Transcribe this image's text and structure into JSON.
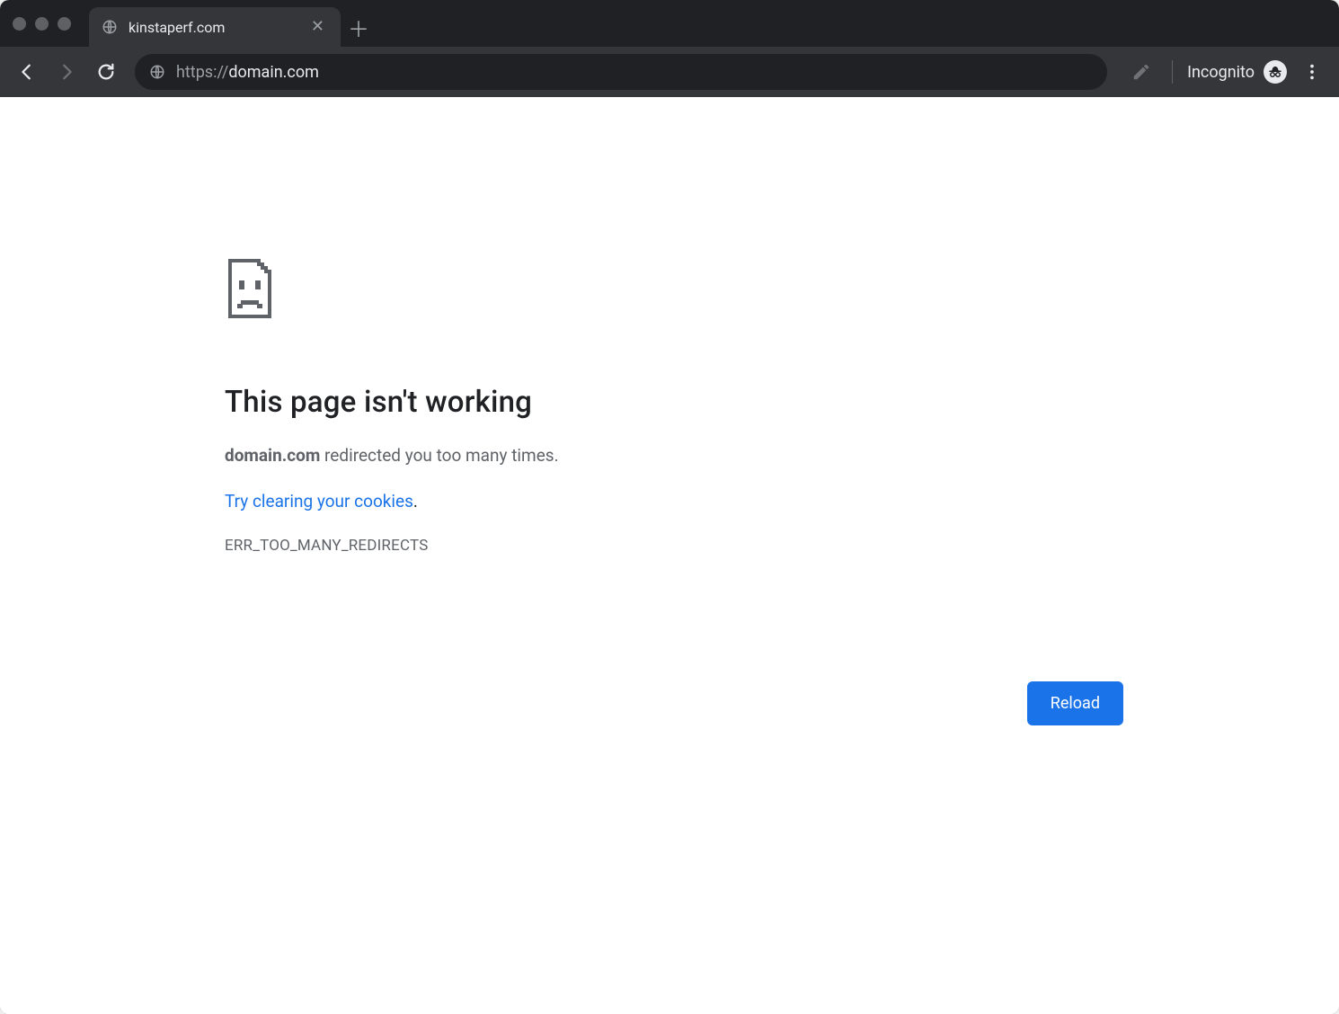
{
  "tab": {
    "title": "kinstaperf.com"
  },
  "toolbar": {
    "url_scheme": "https://",
    "url_host": "domain.com",
    "incognito_label": "Incognito"
  },
  "error": {
    "heading": "This page isn't working",
    "domain": "domain.com",
    "redirect_msg": " redirected you too many times.",
    "clear_cookies_link": "Try clearing your cookies",
    "code": "ERR_TOO_MANY_REDIRECTS",
    "reload_label": "Reload"
  }
}
